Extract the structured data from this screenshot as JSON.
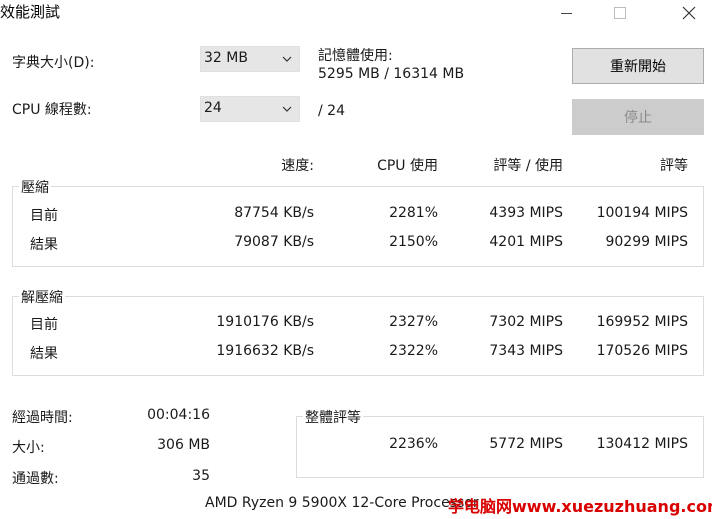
{
  "window": {
    "title": "效能測試",
    "controls": {
      "minimize": "minimize-icon",
      "maximize": "maximize-icon",
      "close": "close-icon"
    }
  },
  "settings": {
    "dict_label": "字典大小(D):",
    "dict_value": "32 MB",
    "threads_label": "CPU 線程數:",
    "threads_value": "24",
    "threads_total": "/ 24",
    "memory_label": "記憶體使用:",
    "memory_value": "5295 MB / 16314 MB"
  },
  "buttons": {
    "restart": "重新開始",
    "stop": "停止"
  },
  "columns": {
    "speed": "速度:",
    "cpu": "CPU 使用",
    "rating_usage": "評等 / 使用",
    "rating": "評等"
  },
  "compress": {
    "label": "壓縮",
    "rows": [
      {
        "name": "目前",
        "speed": "87754 KB/s",
        "cpu": "2281%",
        "rating_usage": "4393 MIPS",
        "rating": "100194 MIPS"
      },
      {
        "name": "結果",
        "speed": "79087 KB/s",
        "cpu": "2150%",
        "rating_usage": "4201 MIPS",
        "rating": "90299 MIPS"
      }
    ]
  },
  "decompress": {
    "label": "解壓縮",
    "rows": [
      {
        "name": "目前",
        "speed": "1910176 KB/s",
        "cpu": "2327%",
        "rating_usage": "7302 MIPS",
        "rating": "169952 MIPS"
      },
      {
        "name": "結果",
        "speed": "1916632 KB/s",
        "cpu": "2322%",
        "rating_usage": "7343 MIPS",
        "rating": "170526 MIPS"
      }
    ]
  },
  "stats": {
    "elapsed_label": "經過時間:",
    "elapsed_value": "00:04:16",
    "size_label": "大小:",
    "size_value": "306 MB",
    "passes_label": "通過數:",
    "passes_value": "35"
  },
  "overall": {
    "label": "整體評等",
    "cpu": "2236%",
    "rating_usage": "5772 MIPS",
    "rating": "130412 MIPS"
  },
  "footer": {
    "cpu_info": "AMD Ryzen 9 5900X 12-Core Processor"
  },
  "watermark": {
    "text": "学电脑网www.xuezuzhuang.com",
    "color": "#d90000"
  }
}
